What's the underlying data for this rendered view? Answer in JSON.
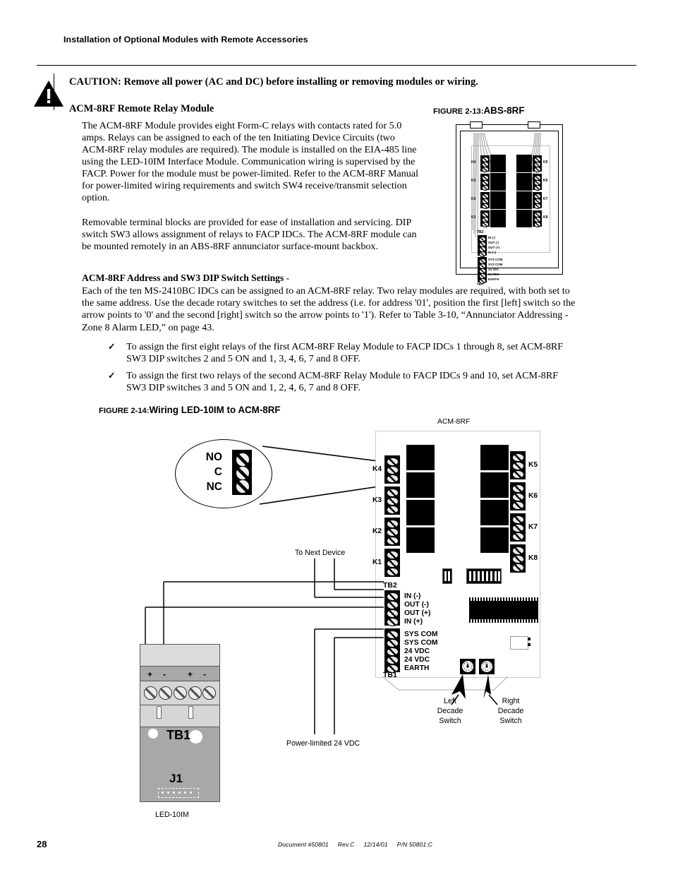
{
  "header": {
    "running_head": "Installation of Optional Modules with Remote Accessories"
  },
  "caution": {
    "icon": "warning-triangle-icon",
    "text": "CAUTION:  Remove all power (AC and DC) before installing or removing modules or wiring."
  },
  "section": {
    "heading": "ACM-8RF Remote Relay Module",
    "paragraph1": "The ACM-8RF Module provides eight Form-C relays with contacts rated for 5.0 amps.  Relays can be assigned to each of the ten Initiating Device Circuits (two ACM-8RF relay modules are required).  The module is installed on the EIA-485 line using the LED-10IM Interface Module.  Communication wiring is supervised by the FACP.  Power for the module must be power-limited.  Refer to the ACM-8RF Manual for power-limited wiring requirements and switch SW4 receive/transmit selection option.",
    "paragraph2": "Removable terminal blocks are provided for ease of installation and servicing.  DIP switch SW3 allows assignment of relays to FACP IDCs.  The ACM-8RF module can be mounted remotely in an ABS-8RF annunciator surface-mount backbox."
  },
  "address_section": {
    "heading": "ACM-8RF Address and SW3 DIP Switch Settings",
    "heading_suffix": " -",
    "paragraph": "Each of the ten MS-2410BC IDCs can be assigned to an ACM-8RF relay.  Two relay modules are required, with both set to the same address.  Use the decade rotary switches to set the address (i.e. for address '01', position the first [left] switch so the arrow points to '0' and the second [right] switch so the arrow points to '1').  Refer to Table 3-10, “Annunciator Addressing - Zone 8 Alarm LED,” on page 43.",
    "bullets": [
      {
        "marker": "✓",
        "text": "To assign the first eight relays of the first ACM-8RF Relay Module to FACP IDCs 1 through 8, set ACM-8RF SW3 DIP switches 2 and 5 ON and 1, 3, 4, 6, 7 and 8 OFF."
      },
      {
        "marker": "✓",
        "text": "To assign the first two relays of the second ACM-8RF Relay Module to FACP IDCs 9 and 10, set ACM-8RF SW3 DIP switches 3 and 5 ON and 1, 2, 4, 6, 7 and 8 OFF."
      }
    ]
  },
  "figure_2_13": {
    "label": "FIGURE 2-13:",
    "title": "ABS-8RF",
    "relay_tags_left": [
      "K4",
      "K3",
      "K2",
      "K1"
    ],
    "relay_tags_right": [
      "K5",
      "K6",
      "K7",
      "K8"
    ],
    "relay_body_tags": [
      "K4",
      "K3",
      "K2",
      "K1",
      "K5",
      "K6",
      "K7",
      "K8"
    ],
    "tb2_name": "TB2",
    "tb1_name": "TB1",
    "tb2_terminals": [
      "IN (-)",
      "OUT (-)",
      "OUT (+)",
      "IN (+)"
    ],
    "tb1_terminals": [
      "SYS COM",
      "SYS COM",
      "24 VDC",
      "24 VDC",
      "EARTH"
    ]
  },
  "figure_2_14": {
    "label": "FIGURE 2-14:",
    "title": "Wiring LED-10IM to ACM-8RF",
    "board_name": "ACM-8RF",
    "callout": {
      "labels": [
        "NO",
        "C",
        "NC"
      ]
    },
    "relay_tags_left": [
      "K4",
      "K3",
      "K2",
      "K1"
    ],
    "relay_tags_right": [
      "K5",
      "K6",
      "K7",
      "K8"
    ],
    "tb2_name": "TB2",
    "tb1_name": "TB1",
    "tb2_terminals": [
      "IN (-)",
      "OUT (-)",
      "OUT (+)",
      "IN (+)"
    ],
    "tb1_terminals": [
      "SYS COM",
      "SYS COM",
      "24 VDC",
      "24 VDC",
      "EARTH"
    ],
    "annotations": {
      "to_next_device": "To Next Device",
      "power_limited": "Power-limited 24 VDC",
      "left_decade": "Left\nDecade\nSwitch",
      "left_decade_l1": "Left",
      "left_decade_l2": "Decade",
      "left_decade_l3": "Switch",
      "right_decade_l1": "Right",
      "right_decade_l2": "Decade",
      "right_decade_l3": "Switch"
    },
    "led10im": {
      "name": "LED-10IM",
      "tb1": "TB1",
      "j1": "J1",
      "polarity": [
        "+",
        "-",
        "+",
        "-"
      ]
    },
    "dip_switches": {
      "sw_small_positions": 2,
      "sw_large_positions": 8
    }
  },
  "footer": {
    "page_number": "28",
    "document": "Document #50801",
    "revision": "Rev.C",
    "date": "12/14/01",
    "part_number": "P/N 50801:C"
  }
}
